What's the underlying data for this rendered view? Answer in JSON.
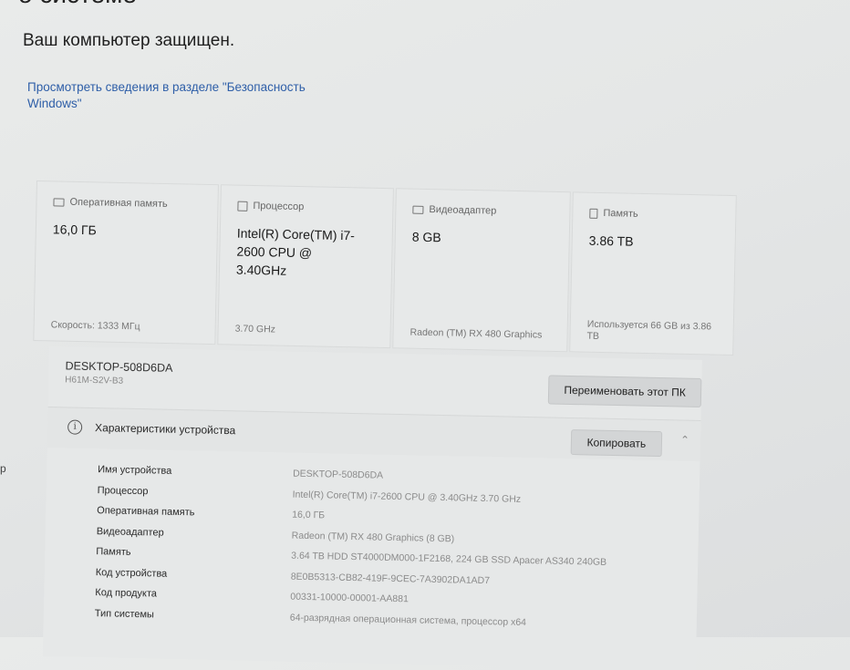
{
  "header": {
    "title_fragment": "о системе",
    "protection_status": "Ваш компьютер защищен.",
    "security_link": "Просмотреть сведения в разделе \"Безопасность Windows\""
  },
  "side_fragment": "р",
  "cards": [
    {
      "label": "Оперативная память",
      "value": "16,0 ГБ",
      "sub": "Скорость: 1333 МГц",
      "icon": "ram-icon"
    },
    {
      "label": "Процессор",
      "value": "Intel(R) Core(TM) i7-2600 CPU @ 3.40GHz",
      "sub": "3.70 GHz",
      "icon": "processor-icon"
    },
    {
      "label": "Видеоадаптер",
      "value": "8 GB",
      "sub": "Radeon (TM) RX 480 Graphics",
      "icon": "gpu-icon"
    },
    {
      "label": "Память",
      "value": "3.86 TB",
      "sub": "Используется 66 GB из 3.86 TB",
      "icon": "storage-icon"
    }
  ],
  "device": {
    "name": "DESKTOP-508D6DA",
    "model": "H61M-S2V-B3",
    "rename_label": "Переименовать этот ПК"
  },
  "specs": {
    "title": "Характеристики устройства",
    "copy_label": "Копировать",
    "rows": [
      {
        "key": "Имя устройства",
        "value": "DESKTOP-508D6DA"
      },
      {
        "key": "Процессор",
        "value": "Intel(R) Core(TM) i7-2600 CPU @ 3.40GHz   3.70 GHz"
      },
      {
        "key": "Оперативная память",
        "value": "16,0 ГБ"
      },
      {
        "key": "Видеоадаптер",
        "value": "Radeon (TM) RX 480 Graphics (8 GB)"
      },
      {
        "key": "Память",
        "value": "3.64 TB HDD ST4000DM000-1F2168, 224 GB SSD Apacer AS340 240GB"
      },
      {
        "key": "Код устройства",
        "value": "8E0B5313-CB82-419F-9CEC-7A3902DA1AD7"
      },
      {
        "key": "Код продукта",
        "value": "00331-10000-00001-AA881"
      },
      {
        "key": "Тип системы",
        "value": "64-разрядная операционная система, процессор x64"
      }
    ]
  }
}
